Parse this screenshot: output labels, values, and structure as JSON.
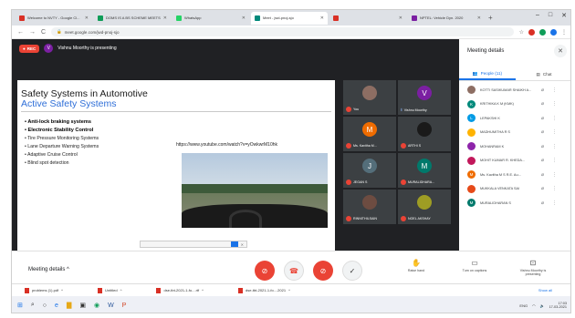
{
  "browser": {
    "tabs": [
      {
        "label": "Welcome to NVTY - Google Cl...",
        "color": "#d93025",
        "active": false
      },
      {
        "label": "DOMS IS A BS SCHEME MEETS",
        "color": "#0f9d58",
        "active": false
      },
      {
        "label": "WhatsApp",
        "color": "#25d366",
        "active": false
      },
      {
        "label": "Meet - jwd-pnoj-sjo",
        "color": "#00897b",
        "active": true
      },
      {
        "label": "",
        "color": "#d93025",
        "active": false
      },
      {
        "label": "NPTEL: Vehicle Dyn. 2020",
        "color": "#7b1fa2",
        "active": false
      }
    ],
    "url": "meet.google.com/jwd-pnoj-sjo"
  },
  "meet": {
    "rec_label": "REC",
    "presenter_initial": "V",
    "presenting_text": "Vishnu Moorthy is presenting"
  },
  "slide": {
    "title": "Safety Systems in Automotive",
    "subtitle": "Active Safety Systems",
    "bullets": [
      {
        "text": "Anti-lock braking systems",
        "bold": true
      },
      {
        "text": "Electronic Stability Control",
        "bold": true
      },
      {
        "text": "Tire Pressure Monitoring Systems",
        "bold": false
      },
      {
        "text": "Lane Departure Warning Systems",
        "bold": false
      },
      {
        "text": "Adaptive Cruise Control",
        "bold": false
      },
      {
        "text": "Blind spot detection",
        "bold": false
      }
    ],
    "youtube_url": "https://www.youtube.com/watch?v=yOwkwrM10hk",
    "overlay_text": "",
    "overlay_button": ""
  },
  "tiles": [
    {
      "initial": "",
      "name": "You",
      "color": "#8d6e63",
      "muted": true
    },
    {
      "initial": "V",
      "name": "Vishnu Moorthy",
      "color": "#7b1fa2",
      "muted": false
    },
    {
      "initial": "M",
      "name": "Ms. Kavitha M...",
      "color": "#ef6c00",
      "muted": true
    },
    {
      "initial": "",
      "name": "ARTHI S",
      "color": "#1a1a1a",
      "muted": true
    },
    {
      "initial": "J",
      "name": "JEGAN S",
      "color": "#546e7a",
      "muted": true
    },
    {
      "initial": "M",
      "name": "MURALIDHARA...",
      "color": "#00796b",
      "muted": true
    },
    {
      "initial": "",
      "name": "RINNITHILSAIN",
      "color": "#6d4c41",
      "muted": true
    },
    {
      "initial": "",
      "name": "NOEL AKSHAY",
      "color": "#9e9d24",
      "muted": true
    }
  ],
  "panel": {
    "title": "Meeting details",
    "people_tab": "People (11)",
    "chat_tab": "Chat",
    "people": [
      {
        "initial": "",
        "name": "KOTTI SASIKUMAR SHAIKH A...",
        "color": "#8d6e63"
      },
      {
        "initial": "K",
        "name": "KRITHIKA K M (KMK)",
        "color": "#00897b"
      },
      {
        "initial": "L",
        "name": "LEPAKSHI K",
        "color": "#039be5"
      },
      {
        "initial": "",
        "name": "MADHUMITHA R S",
        "color": "#ffb300"
      },
      {
        "initial": "",
        "name": "MOHANRAM K",
        "color": "#8e24aa"
      },
      {
        "initial": "",
        "name": "MOHIT KUMAR R. KHEDA...",
        "color": "#c2185b"
      },
      {
        "initial": "M",
        "name": "Ms. Kavitha M S R.E. Au...",
        "color": "#ef6c00"
      },
      {
        "initial": "",
        "name": "MUKKALA VENKATA SAI",
        "color": "#e64a19"
      },
      {
        "initial": "M",
        "name": "MURALIDHARAN S",
        "color": "#00796b"
      }
    ]
  },
  "bottom": {
    "meeting_details": "Meeting details",
    "raise_hand": "Raise hand",
    "captions": "Turn on captions",
    "presenting": "Vishnu Moorthy is presenting"
  },
  "downloads": {
    "items": [
      "problems (1).pdf",
      "Untitled",
      "dse-tbt-2021-1-fo....rtf",
      "dse-tbt-2021-1-fo....2021"
    ],
    "show_all": "Show all"
  },
  "taskbar": {
    "lang": "ENG",
    "time": "17:03",
    "date": "17-03-2021"
  }
}
